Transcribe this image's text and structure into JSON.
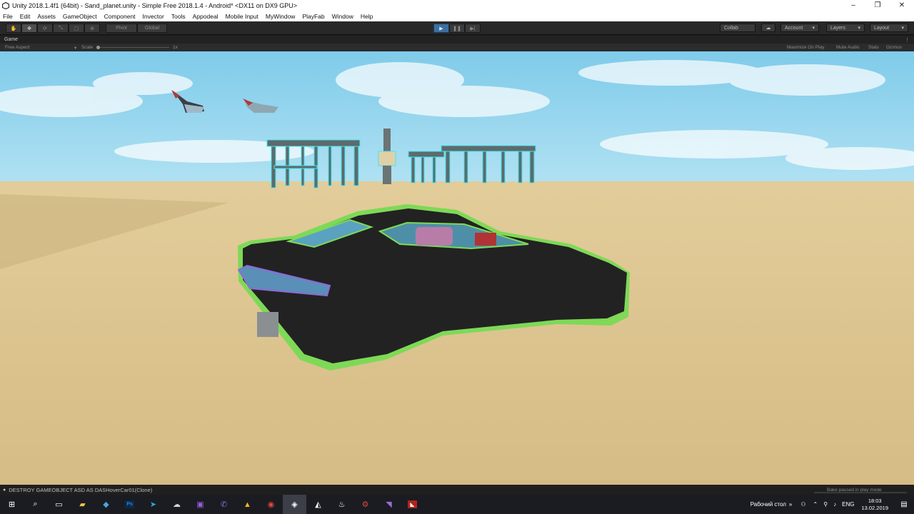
{
  "window": {
    "title": "Unity 2018.1.4f1 (64bit) - Sand_planet.unity - Simple Free 2018.1.4 - Android* <DX11 on DX9 GPU>",
    "controls": [
      "–",
      "❐",
      "✕"
    ]
  },
  "menu": [
    "File",
    "Edit",
    "Assets",
    "GameObject",
    "Component",
    "Invector",
    "Tools",
    "Appodeal",
    "Mobile Input",
    "MyWindow",
    "PlayFab",
    "Window",
    "Help"
  ],
  "toolbar": {
    "pivot_label": "Pivot",
    "global_label": "Global",
    "collab_label": "Collab",
    "account_label": "Account",
    "layers_label": "Layers",
    "layout_label": "Layout"
  },
  "game_view": {
    "tab_label": "Game",
    "aspect_label": "Free Aspect",
    "scale_label": "Scale",
    "scale_value": "1x",
    "maximize_label": "Maximize On Play",
    "mute_label": "Mute Audio",
    "stats_label": "Stats",
    "gizmos_label": "Gizmos"
  },
  "status": {
    "console_message": "DESTROY GAMEOBJECT ASD AS DASHoverCar01(Clone)",
    "bake_message": "Bake paused in play mode"
  },
  "taskbar": {
    "desktop_label": "Рабочий стол",
    "language": "ENG",
    "time": "18:03",
    "date": "13.02.2019"
  },
  "colors": {
    "sky": "#8fd3ee",
    "sand": "#d9c08b",
    "car_body": "#222222",
    "car_trim": "#7ed957"
  }
}
